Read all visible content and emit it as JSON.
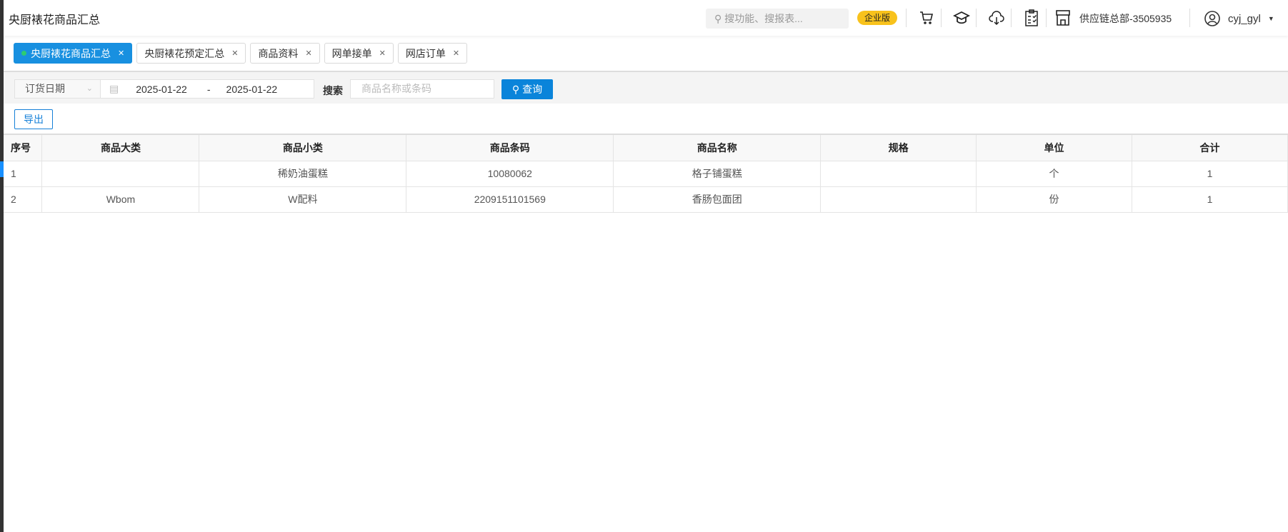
{
  "header": {
    "title": "央厨裱花商品汇总",
    "search_placeholder": "搜功能、搜报表...",
    "edition_badge": "企业版",
    "store": "供应链总部-3505935",
    "username": "cyj_gyl"
  },
  "tabs": [
    {
      "label": "央厨裱花商品汇总",
      "active": true
    },
    {
      "label": "央厨裱花预定汇总"
    },
    {
      "label": "商品资料"
    },
    {
      "label": "网单接单"
    },
    {
      "label": "网店订单"
    }
  ],
  "filter": {
    "date_type": "订货日期",
    "start_date": "2025-01-22",
    "separator": "-",
    "end_date": "2025-01-22",
    "search_label": "搜索",
    "search_placeholder": "商品名称或条码",
    "query_button": "查询"
  },
  "export_button": "导出",
  "table": {
    "columns": [
      "序号",
      "商品大类",
      "商品小类",
      "商品条码",
      "商品名称",
      "规格",
      "单位",
      "合计"
    ],
    "rows": [
      [
        "1",
        "",
        "稀奶油蛋糕",
        "10080062",
        "格子铺蛋糕",
        "",
        "个",
        "1"
      ],
      [
        "2",
        "Wbom",
        "W配料",
        "2209151101569",
        "香肠包面团",
        "",
        "份",
        "1"
      ]
    ]
  },
  "colors": {
    "primary": "#1890e0",
    "badge": "#f8c21c"
  }
}
